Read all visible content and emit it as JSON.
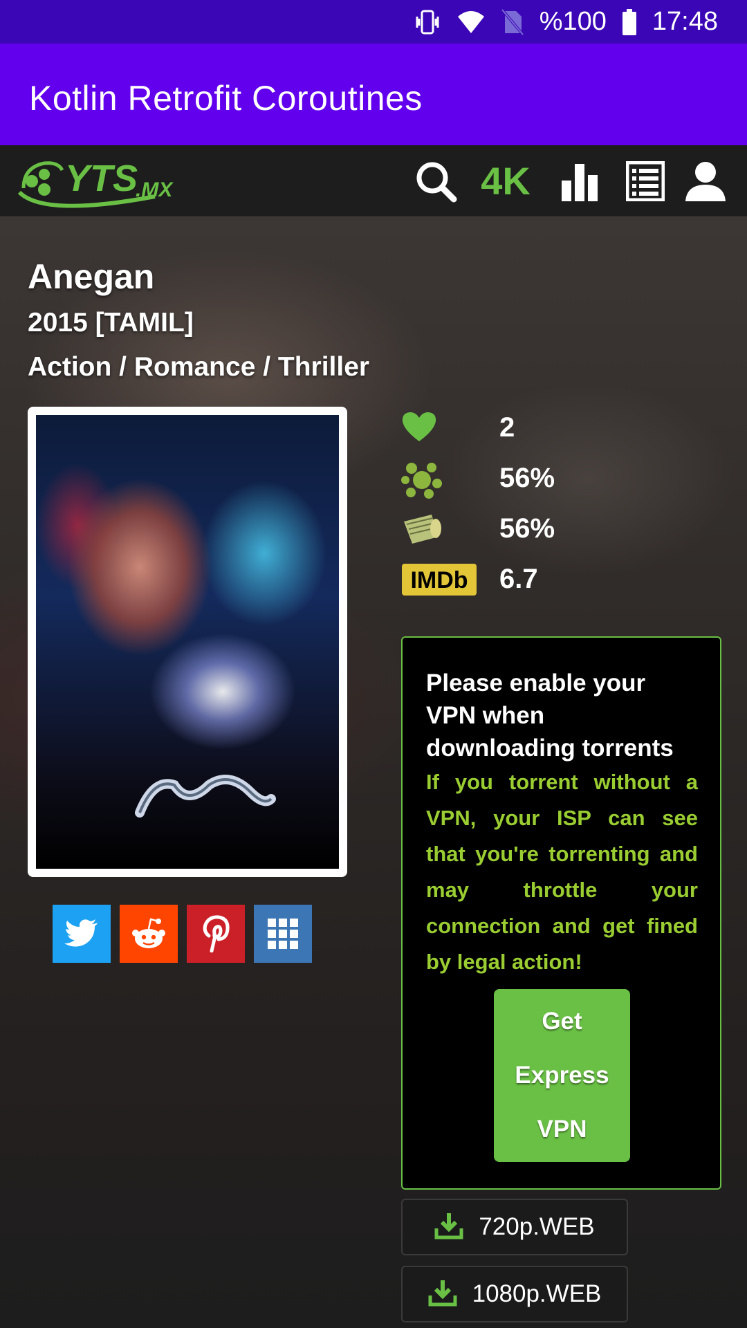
{
  "status_bar": {
    "battery": "%100",
    "time": "17:48",
    "icons": [
      "vibrate-icon",
      "wifi-icon",
      "no-sim-icon",
      "battery-icon"
    ]
  },
  "app_bar": {
    "title": "Kotlin Retrofit Coroutines"
  },
  "site_nav": {
    "logo_text": "YTS.MX",
    "items": [
      {
        "name": "search-icon"
      },
      {
        "name": "4k-link",
        "label": "4K"
      },
      {
        "name": "trending-icon"
      },
      {
        "name": "browse-list-icon"
      },
      {
        "name": "user-icon"
      }
    ]
  },
  "movie": {
    "title": "Anegan",
    "year_lang": "2015 [TAMIL]",
    "genres": "Action / Romance / Thriller",
    "likes": "2",
    "critics_score": "56%",
    "audience_score": "56%",
    "imdb_label": "IMDb",
    "imdb_rating": "6.7"
  },
  "share": [
    "twitter-icon",
    "reddit-icon",
    "pinterest-icon",
    "more-apps-icon"
  ],
  "vpn": {
    "heading": "Please enable your VPN when downloading torrents",
    "body": "If you torrent without a VPN, your ISP can see that you're torrenting and may throttle your connection and get fined by legal action!",
    "button": "Get Express VPN"
  },
  "downloads": [
    {
      "label": "720p.WEB"
    },
    {
      "label": "1080p.WEB"
    }
  ],
  "colors": {
    "accent": "#6ac045",
    "app_bar": "#6200ee",
    "status_bar": "#3b06b5",
    "warning_text": "#9acd32"
  }
}
